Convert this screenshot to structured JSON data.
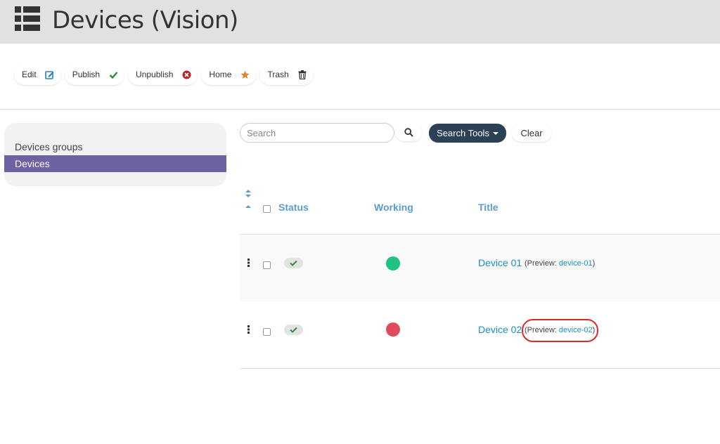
{
  "header": {
    "title": "Devices (Vision)",
    "icon": "list-icon"
  },
  "toolbar": {
    "edit_label": "Edit",
    "publish_label": "Publish",
    "unpublish_label": "Unpublish",
    "home_label": "Home",
    "trash_label": "Trash"
  },
  "sidebar": {
    "items": [
      {
        "label": "Devices groups",
        "active": false
      },
      {
        "label": "Devices",
        "active": true
      }
    ]
  },
  "search": {
    "placeholder": "Search",
    "value": "",
    "tools_label": "Search Tools",
    "clear_label": "Clear"
  },
  "table": {
    "columns": {
      "status": "Status",
      "working": "Working",
      "title": "Title"
    },
    "rows": [
      {
        "title": "Device 01",
        "preview_prefix": "(Preview: ",
        "preview_alias": "device-01",
        "preview_suffix": ")",
        "status": "published",
        "working_color": "#1fc283"
      },
      {
        "title": "Device 02",
        "preview_prefix": "(Preview: ",
        "preview_alias": "device-02",
        "preview_suffix": ")",
        "status": "published",
        "working_color": "#e04b5b"
      }
    ]
  },
  "colors": {
    "accent": "#6f62a3",
    "search_tools": "#2c4156",
    "link": "#1a8fc4",
    "highlight_ring": "#e0282b"
  }
}
